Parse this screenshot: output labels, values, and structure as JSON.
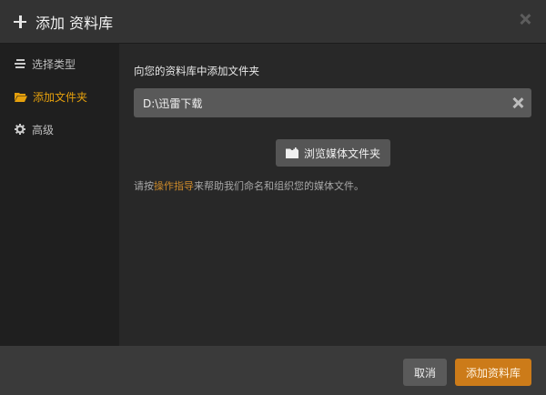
{
  "dialog": {
    "title": "添加 资料库",
    "close_icon": "close-icon"
  },
  "sidebar": {
    "items": [
      {
        "label": "选择类型",
        "icon": "list-icon",
        "active": false
      },
      {
        "label": "添加文件夹",
        "icon": "folder-open-icon",
        "active": true
      },
      {
        "label": "高级",
        "icon": "gear-icon",
        "active": false
      }
    ]
  },
  "main": {
    "section_label": "向您的资料库中添加文件夹",
    "folder_path_value": "D:\\迅雷下载",
    "browse_button_label": "浏览媒体文件夹",
    "help_prefix": "请按",
    "help_link": "操作指导",
    "help_suffix": "来帮助我们命名和组织您的媒体文件。"
  },
  "footer": {
    "cancel_label": "取消",
    "add_label": "添加资料库"
  },
  "colors": {
    "accent": "#e5a00d",
    "primary_button": "#cc7b19",
    "background": "#282828"
  }
}
